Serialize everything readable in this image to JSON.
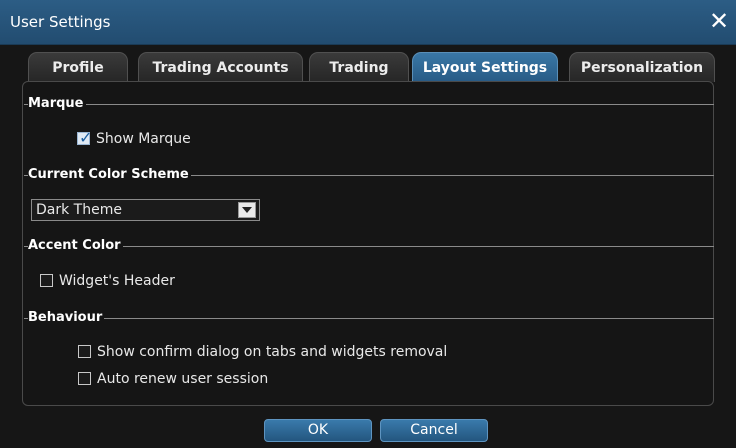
{
  "window": {
    "title": "User Settings",
    "close_label": "✕"
  },
  "tabs": [
    {
      "label": "Profile",
      "active": false
    },
    {
      "label": "Trading Accounts",
      "active": false
    },
    {
      "label": "Trading",
      "active": false
    },
    {
      "label": "Layout Settings",
      "active": true
    },
    {
      "label": "Personalization",
      "active": false
    }
  ],
  "groups": {
    "marque": {
      "title": "Marque",
      "show_marque": {
        "label": "Show Marque",
        "checked": true
      }
    },
    "color_scheme": {
      "title": "Current Color Scheme",
      "selected": "Dark Theme"
    },
    "accent_color": {
      "title": "Accent Color",
      "widget_header": {
        "label": "Widget's Header",
        "checked": false
      }
    },
    "behaviour": {
      "title": "Behaviour",
      "confirm_removal": {
        "label": "Show confirm dialog on tabs and widgets removal",
        "checked": false
      },
      "auto_renew": {
        "label": "Auto renew user session",
        "checked": false
      }
    }
  },
  "buttons": {
    "ok": "OK",
    "cancel": "Cancel"
  },
  "colors": {
    "titlebar": "#2b5a82",
    "active_tab": "#2f6a99",
    "button": "#2d6894",
    "background": "#161616",
    "panel_border": "#4a4a4a"
  },
  "icons": {
    "close": "close-icon",
    "dropdown": "chevron-down-icon",
    "checkmark": "checkmark-icon"
  }
}
